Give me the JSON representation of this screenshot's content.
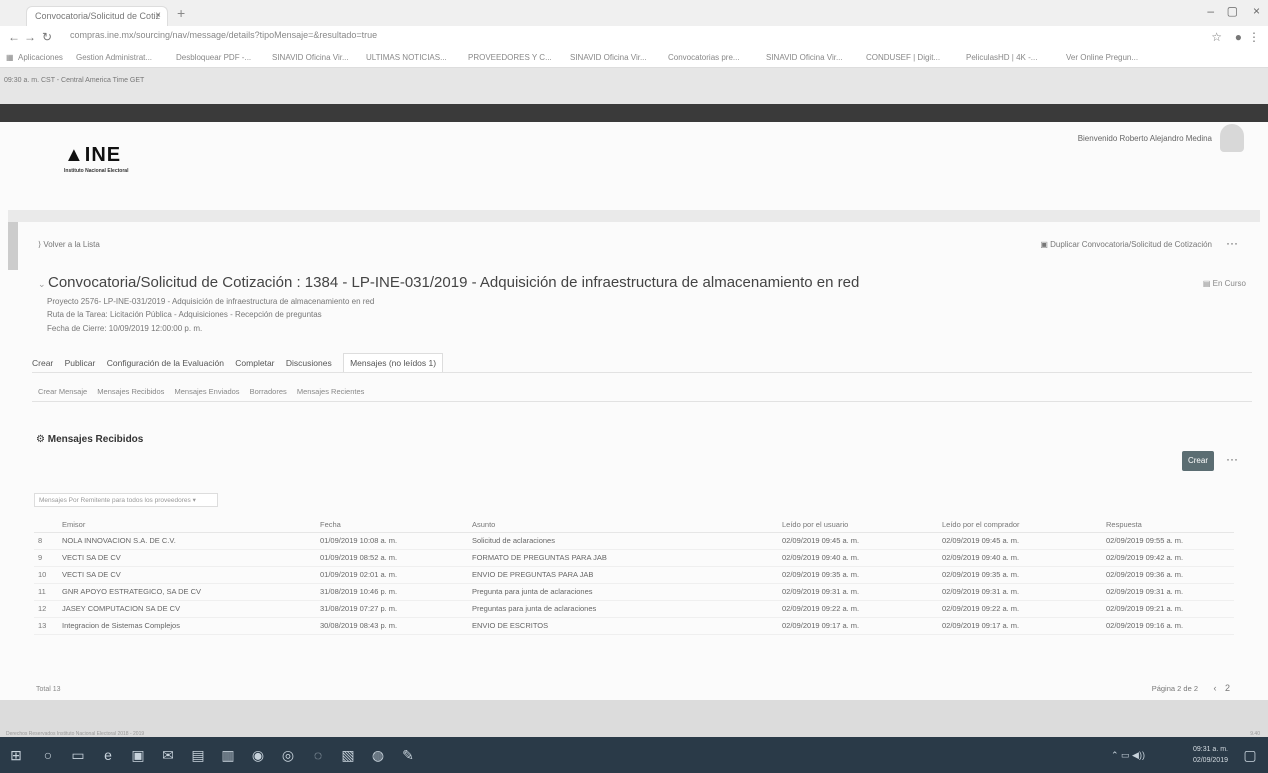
{
  "browser": {
    "tab_title": "Convocatoria/Solicitud de Cotiz",
    "tab_close": "×",
    "new_tab": "+",
    "window_controls": [
      "–",
      "▢",
      "×"
    ],
    "url": "compras.ine.mx/sourcing/nav/message/details?tipoMensaje=&resultado=true",
    "bookmarks": [
      "Aplicaciones",
      "Gestion Administrat...",
      "Desbloquear PDF -...",
      "SINAVID Oficina Vir...",
      "ULTIMAS NOTICIAS...",
      "PROVEEDORES Y C...",
      "SINAVID Oficina Vir...",
      "Convocatorias pre...",
      "SINAVID Oficina Vir...",
      "CONDUSEF | Digit...",
      "PeliculasHD | 4K -...",
      "Ver Online Pregun..."
    ]
  },
  "infobar": {
    "text": "09:30 a. m. CST - Central America Time GET"
  },
  "header": {
    "user_name": "Bienvenido Roberto Alejandro Medina",
    "logo_text": "INE",
    "logo_sub": "Instituto Nacional Electoral"
  },
  "page": {
    "back_link": "Volver a la Lista",
    "duplicate_link": "Duplicar Convocatoria/Solicitud de Cotización",
    "more": "···",
    "title": "Convocatoria/Solicitud de Cotización : 1384 - LP-INE-031/2019 - Adquisición de infraestructura de almacenamiento en red",
    "status": "En Curso",
    "project": "Proyecto 2576- LP-INE-031/2019 - Adquisición de infraestructura de almacenamiento en red",
    "task_route": "Ruta de la Tarea: Licitación Pública - Adquisiciones - Recepción de preguntas",
    "close_date": "Fecha de Cierre: 10/09/2019 12:00:00 p. m.",
    "nav_tabs": [
      "Crear",
      "Publicar",
      "Configuración de la Evaluación",
      "Completar",
      "Discusiones",
      "Mensajes (no leídos 1)"
    ],
    "sub_tabs": [
      "Crear Mensaje",
      "Mensajes Recibidos",
      "Mensajes Enviados",
      "Borradores",
      "Mensajes Recientes"
    ],
    "section_title": "Mensajes Recibidos",
    "create_button": "Crear",
    "filter_placeholder": "Mensajes Por Remitente para todos los proveedores"
  },
  "table": {
    "headers": [
      "",
      "Emisor",
      "Fecha",
      "Asunto",
      "Leído por el usuario",
      "Leído por el comprador",
      "Respuesta"
    ],
    "rows": [
      [
        "8",
        "NOLA INNOVACION S.A. DE C.V.",
        "01/09/2019 10:08 a. m.",
        "Solicitud de aclaraciones",
        "02/09/2019 09:45 a. m.",
        "02/09/2019 09:45 a. m.",
        "02/09/2019 09:55 a. m."
      ],
      [
        "9",
        "VECTI SA DE CV",
        "01/09/2019 08:52 a. m.",
        "FORMATO DE PREGUNTAS PARA JAB",
        "02/09/2019 09:40 a. m.",
        "02/09/2019 09:40 a. m.",
        "02/09/2019 09:42 a. m."
      ],
      [
        "10",
        "VECTI SA DE CV",
        "01/09/2019 02:01 a. m.",
        "ENVIO DE PREGUNTAS PARA JAB",
        "02/09/2019 09:35 a. m.",
        "02/09/2019 09:35 a. m.",
        "02/09/2019 09:36 a. m."
      ],
      [
        "11",
        "GNR APOYO ESTRATEGICO, SA DE CV",
        "31/08/2019 10:46 p. m.",
        "Pregunta para junta de aclaraciones",
        "02/09/2019 09:31 a. m.",
        "02/09/2019 09:31 a. m.",
        "02/09/2019 09:31 a. m."
      ],
      [
        "12",
        "JASEY COMPUTACION SA DE CV",
        "31/08/2019 07:27 p. m.",
        "Preguntas para junta de aclaraciones",
        "02/09/2019 09:22 a. m.",
        "02/09/2019 09:22 a. m.",
        "02/09/2019 09:21 a. m."
      ],
      [
        "13",
        "Integracion de Sistemas Complejos",
        "30/08/2019 08:43 p. m.",
        "ENVIO DE ESCRITOS",
        "02/09/2019 09:17 a. m.",
        "02/09/2019 09:17 a. m.",
        "02/09/2019 09:16 a. m."
      ]
    ]
  },
  "pagination": {
    "total": "Total 13",
    "page_label": "Página 2 de 2",
    "prev": "‹",
    "next": "2"
  },
  "footer": {
    "text": "Derechos Reservados Instituto Nacional Electoral 2018 - 2019",
    "version": "9.40"
  },
  "taskbar": {
    "time": "09:31 a. m.",
    "date": "02/09/2019"
  }
}
